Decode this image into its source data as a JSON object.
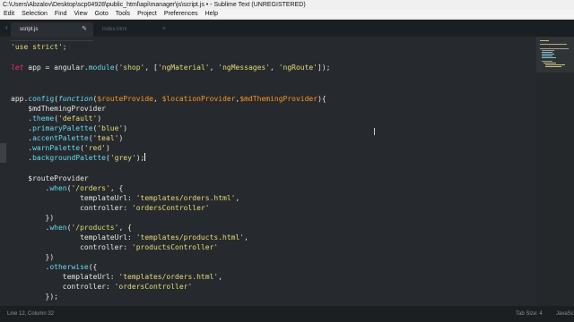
{
  "window": {
    "title": "C:\\Users\\Abzalov\\Desktop\\scp04928\\public_html\\api\\manager\\js\\script.js • - Sublime Text (UNREGISTERED)"
  },
  "menu": [
    "Edit",
    "Selection",
    "Find",
    "View",
    "Goto",
    "Tools",
    "Project",
    "Preferences",
    "Help"
  ],
  "tabs": [
    {
      "label": "script.js",
      "icon": "pencil-icon",
      "active": true
    },
    {
      "label": "index.html",
      "icon": "close-icon",
      "active": false
    }
  ],
  "code": {
    "l1": [
      "'use strict';"
    ],
    "l3": [
      "let",
      " app = ",
      "angular",
      ".",
      "module",
      "(",
      "'shop'",
      ", [",
      "'ngMaterial'",
      ", ",
      "'ngMessages'",
      ", ",
      "'ngRoute'",
      "]);"
    ],
    "l6": [
      "app",
      ".",
      "config",
      "(",
      "function",
      "(",
      "$routeProvide",
      ", ",
      "$locationProvider",
      ",",
      "$mdThemingProvider",
      "){"
    ],
    "l7": [
      "    $mdThemingProvider"
    ],
    "l8": [
      "    .",
      "theme",
      "(",
      "'default'",
      ")"
    ],
    "l9": [
      "    .",
      "primaryPalette",
      "(",
      "'blue'",
      ")"
    ],
    "l10": [
      "    .",
      "accentPalette",
      "(",
      "'teal'",
      ")"
    ],
    "l11": [
      "    .",
      "warnPalette",
      "(",
      "'red'",
      ")"
    ],
    "l12": [
      "    .",
      "backgroundPalette",
      "(",
      "'grey'",
      ");"
    ],
    "l14": [
      "    $routeProvider"
    ],
    "l15": [
      "        .",
      "when",
      "(",
      "'/orders'",
      ", {"
    ],
    "l16": [
      "                templateUrl",
      ": ",
      "'templates/orders.html'",
      ","
    ],
    "l17": [
      "                controller",
      ": ",
      "'ordersController'"
    ],
    "l18": [
      "        })"
    ],
    "l19": [
      "        .",
      "when",
      "(",
      "'/products'",
      ", {"
    ],
    "l20": [
      "                templateUrl",
      ": ",
      "'templates/products.html'",
      ","
    ],
    "l21": [
      "                controller",
      ": ",
      "'productsController'"
    ],
    "l22": [
      "        })"
    ],
    "l23": [
      "        .",
      "otherwise",
      "({"
    ],
    "l24": [
      "            templateUrl",
      ": ",
      "'templates/orders.html'",
      ","
    ],
    "l25": [
      "            controller",
      ": ",
      "'ordersController'"
    ],
    "l26": [
      "        });"
    ]
  },
  "status": {
    "position": "Line 12, Column 32",
    "tab_size": "Tab Size: 4",
    "syntax": "JavaScript"
  },
  "colors": {
    "background": "#262a2e",
    "keyword": "#f92672",
    "string": "#e6db74",
    "variable": "#fd971f",
    "function": "#66d9ef"
  }
}
